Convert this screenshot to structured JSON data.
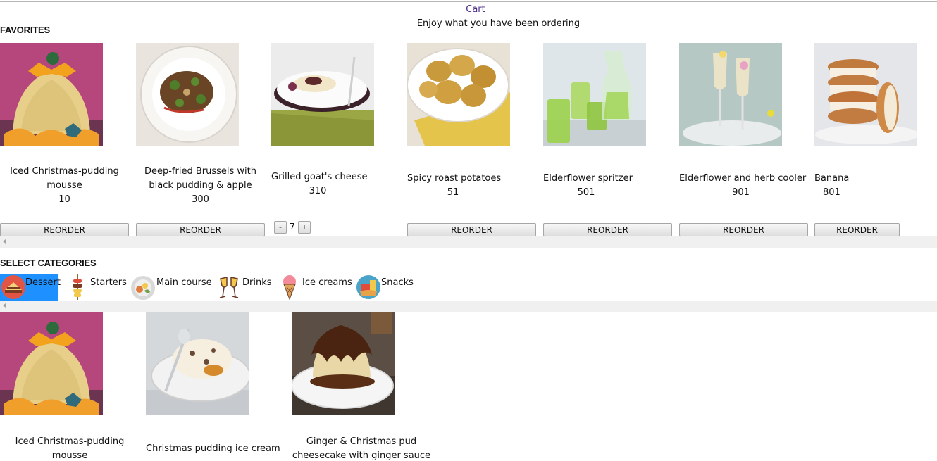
{
  "header": {
    "cart_label": "Cart",
    "tagline": "Enjoy what you have been ordering"
  },
  "favorites": {
    "title": "FAVORITES",
    "reorder_label": "REORDER",
    "items": [
      {
        "name_lines": [
          "Iced Christmas-pudding",
          "mousse"
        ],
        "price": "10"
      },
      {
        "name_lines": [
          "Deep-fried Brussels with",
          "black pudding & apple"
        ],
        "price": "300"
      },
      {
        "name_lines": [
          "Grilled goat's cheese"
        ],
        "price": "310",
        "stepper": {
          "minus": "-",
          "qty": "7",
          "plus": "+"
        }
      },
      {
        "name_lines": [
          "Spicy roast potatoes"
        ],
        "price": "51"
      },
      {
        "name_lines": [
          "Elderflower spritzer"
        ],
        "price": "501"
      },
      {
        "name_lines": [
          "Elderflower and herb cooler"
        ],
        "price": "901"
      },
      {
        "name_lines": [
          "Banana"
        ],
        "price": "801"
      }
    ]
  },
  "categories": {
    "title": "SELECT CATEGORIES",
    "selected": "Dessert",
    "items": [
      {
        "label": "Dessert",
        "icon": "cake-slice-icon"
      },
      {
        "label": "Starters",
        "icon": "skewer-icon"
      },
      {
        "label": "Main course",
        "icon": "plate-icon"
      },
      {
        "label": "Drinks",
        "icon": "cheers-glasses-icon"
      },
      {
        "label": "Ice creams",
        "icon": "ice-cream-cone-icon"
      },
      {
        "label": "Snacks",
        "icon": "snacks-icon"
      }
    ],
    "active_color": "#1e90ff"
  },
  "products": {
    "items": [
      {
        "name_lines": [
          "Iced Christmas-pudding",
          "mousse"
        ]
      },
      {
        "name_lines": [
          "Christmas pudding ice cream"
        ]
      },
      {
        "name_lines": [
          "Ginger & Christmas pud",
          "cheesecake with ginger sauce"
        ]
      }
    ]
  }
}
